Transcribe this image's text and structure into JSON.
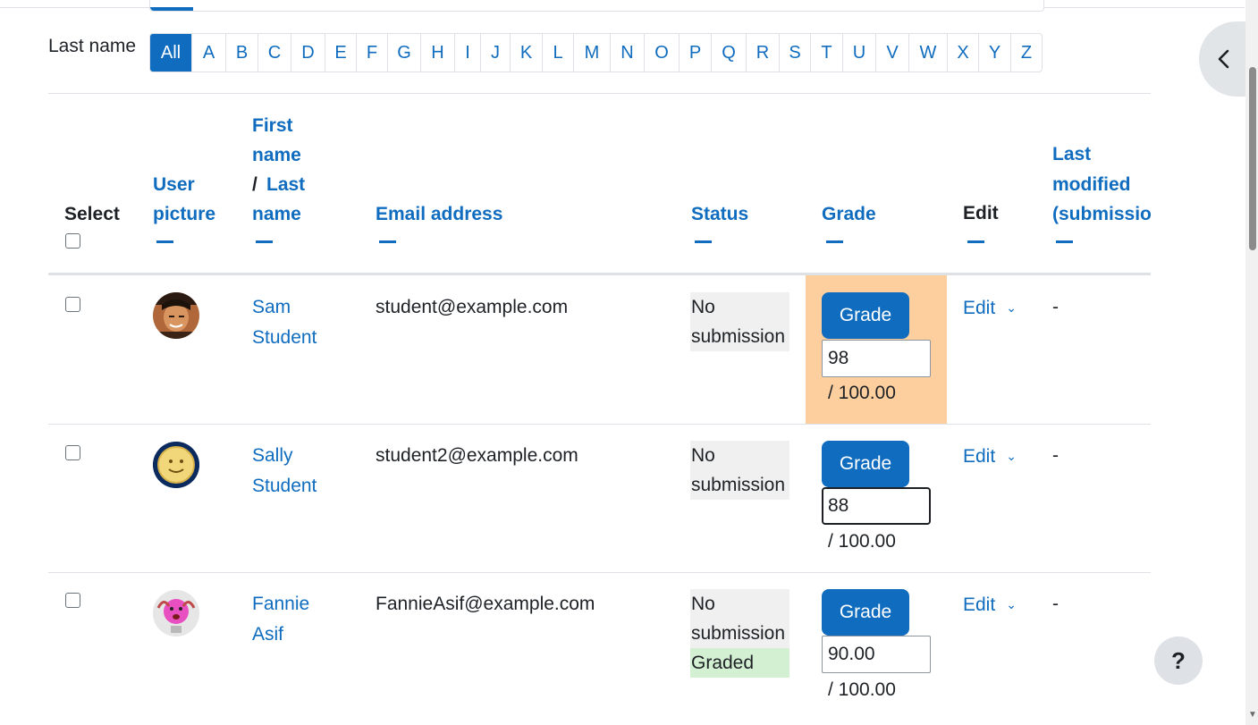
{
  "filter": {
    "label": "Last name",
    "initials": [
      "All",
      "A",
      "B",
      "C",
      "D",
      "E",
      "F",
      "G",
      "H",
      "I",
      "J",
      "K",
      "L",
      "M",
      "N",
      "O",
      "P",
      "Q",
      "R",
      "S",
      "T",
      "U",
      "V",
      "W",
      "X",
      "Y",
      "Z"
    ],
    "active": "All"
  },
  "table": {
    "headers": {
      "select": "Select",
      "user_picture_1": "User",
      "user_picture_2": "picture",
      "first_name_1": "First",
      "first_name_2": "name",
      "slash": "/ ",
      "last_name_1": "Last",
      "last_name_2": "name",
      "email": "Email address",
      "status": "Status",
      "grade": "Grade",
      "edit": "Edit",
      "last_modified_1": "Last",
      "last_modified_2": "modified",
      "last_modified_3": "(submissio"
    },
    "rows": [
      {
        "first": "Sam",
        "last": "Student",
        "email": "student@example.com",
        "status_1": "No",
        "status_2": "submission",
        "status_3": "",
        "grade_button": "Grade",
        "grade_value": "98",
        "grade_max": "/ 100.00",
        "edit": "Edit",
        "last_modified": "-"
      },
      {
        "first": "Sally",
        "last": "Student",
        "email": "student2@example.com",
        "status_1": "No",
        "status_2": "submission",
        "status_3": "",
        "grade_button": "Grade",
        "grade_value": "88",
        "grade_max": "/ 100.00",
        "edit": "Edit",
        "last_modified": "-"
      },
      {
        "first": "Fannie",
        "last": "Asif",
        "email": "FannieAsif@example.com",
        "status_1": "No",
        "status_2": "submission",
        "status_3": "Graded",
        "grade_button": "Grade",
        "grade_value": "90.00",
        "grade_max": "/ 100.00",
        "edit": "Edit",
        "last_modified": "-"
      }
    ]
  },
  "help": {
    "label": "?"
  },
  "colors": {
    "link": "#0f6cbf",
    "highlight": "#fdcf9e",
    "graded": "#d4f0d3",
    "nosubmission": "#f0f0f0"
  }
}
